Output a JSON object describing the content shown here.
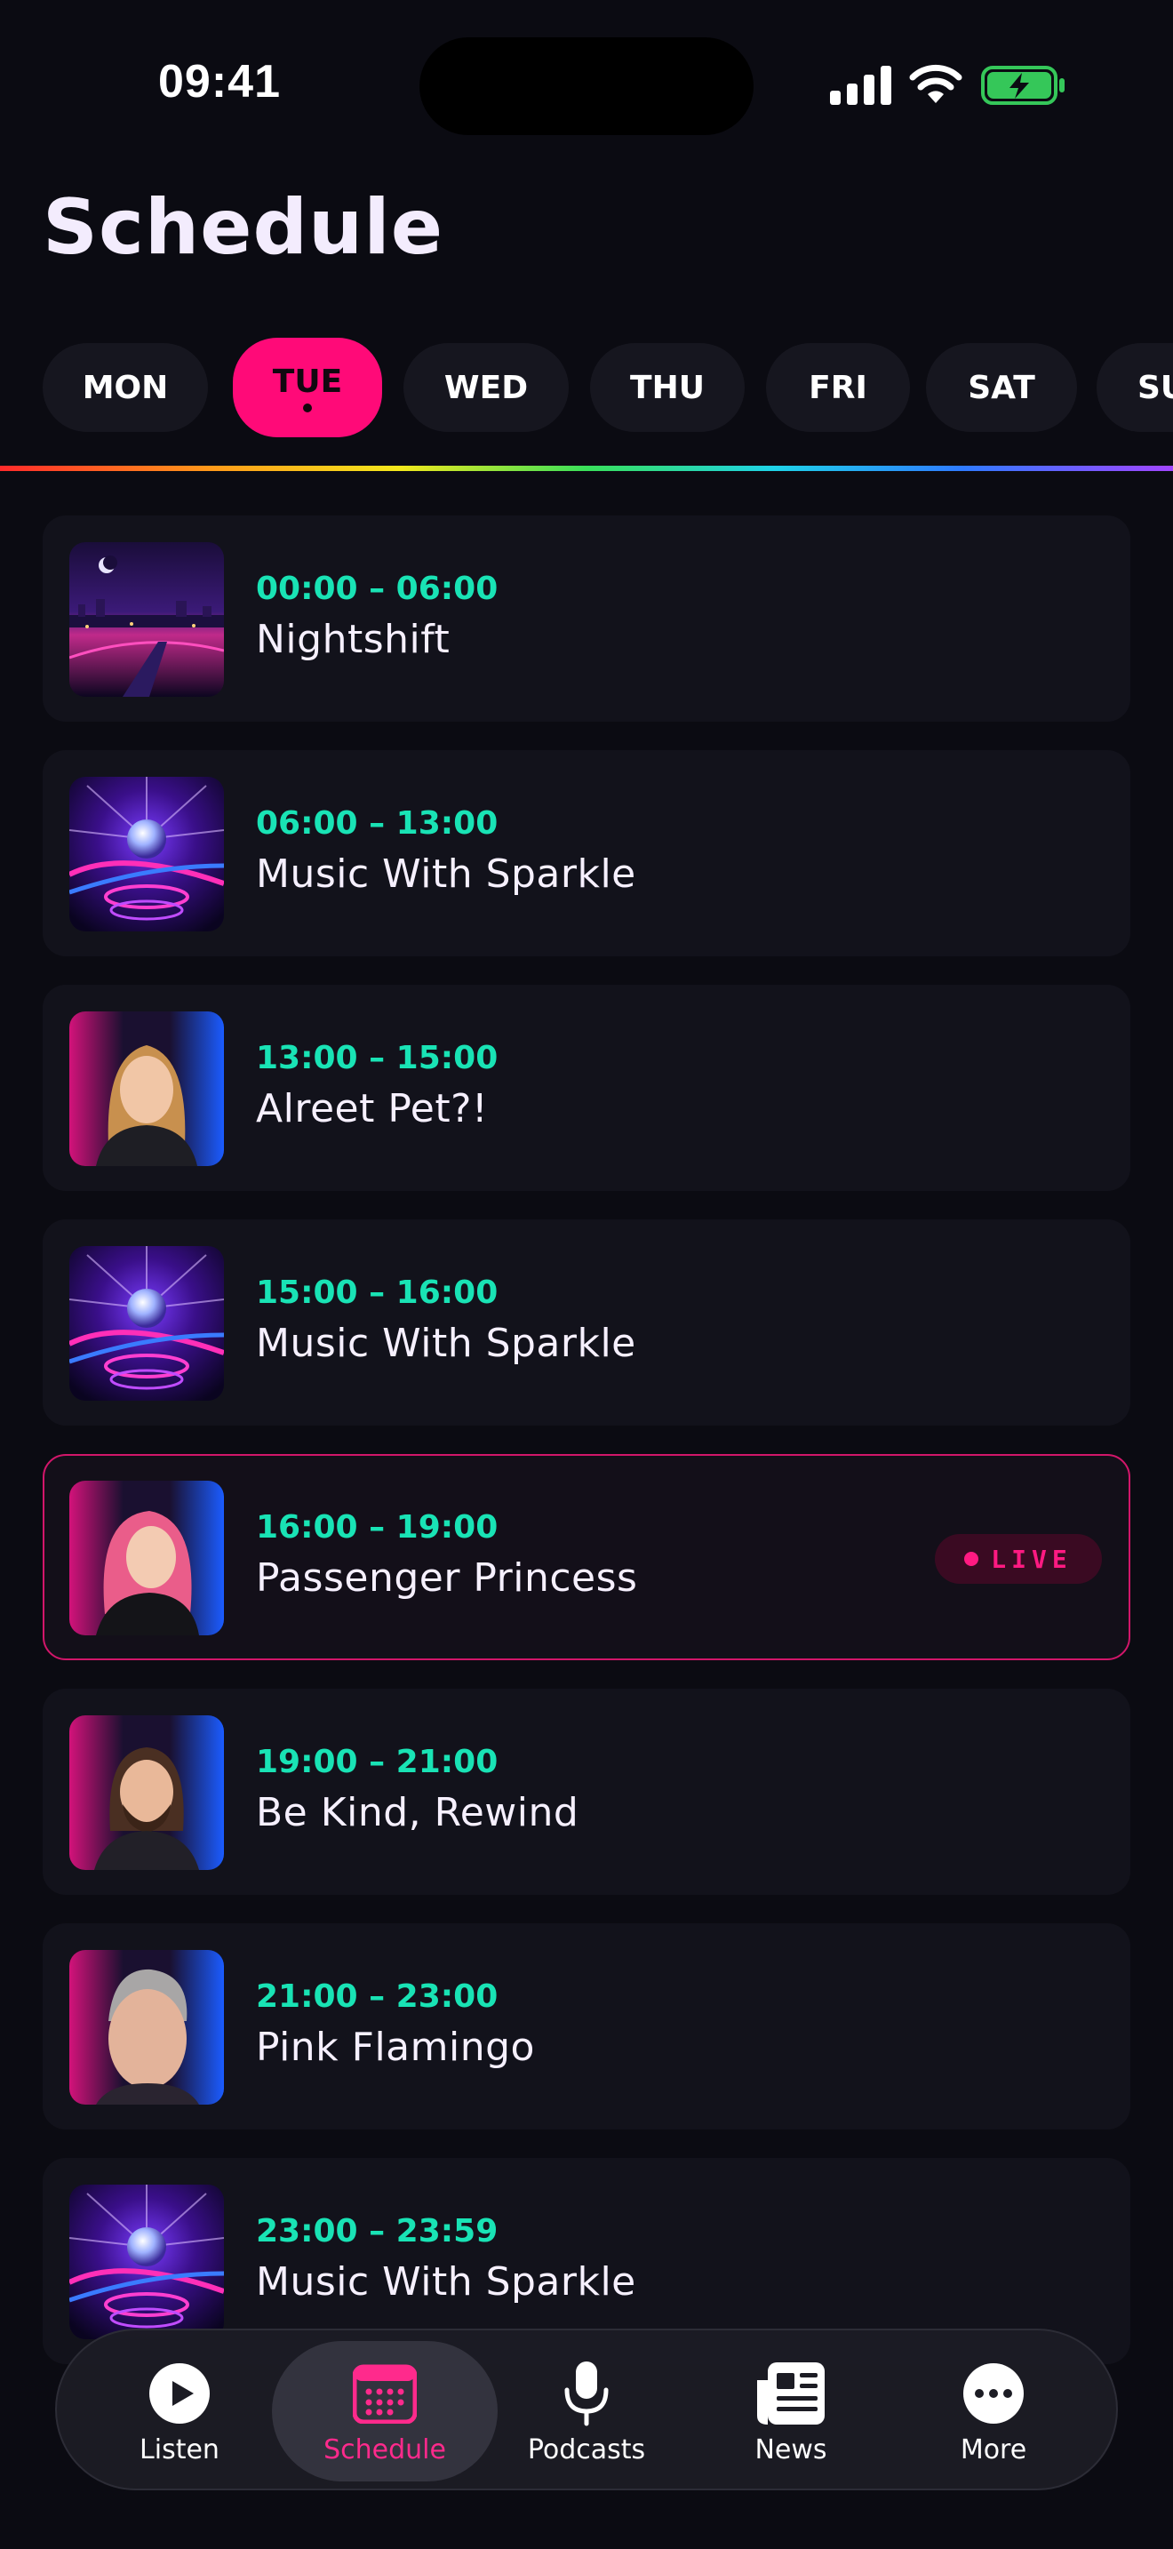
{
  "status_bar": {
    "time": "09:41"
  },
  "page": {
    "title": "Schedule"
  },
  "days": [
    {
      "label": "MON",
      "active": false
    },
    {
      "label": "TUE",
      "active": true
    },
    {
      "label": "WED",
      "active": false
    },
    {
      "label": "THU",
      "active": false
    },
    {
      "label": "FRI",
      "active": false
    },
    {
      "label": "SAT",
      "active": false
    },
    {
      "label": "SUN",
      "active": false
    }
  ],
  "shows": [
    {
      "time": "00:00 – 06:00",
      "title": "Nightshift",
      "art": "night-city-art"
    },
    {
      "time": "06:00 – 13:00",
      "title": "Music With Sparkle",
      "art": "disco-ball-art"
    },
    {
      "time": "13:00 – 15:00",
      "title": "Alreet Pet?!",
      "art": "presenter-photo"
    },
    {
      "time": "15:00 – 16:00",
      "title": "Music With Sparkle",
      "art": "disco-ball-art"
    },
    {
      "time": "16:00 – 19:00",
      "title": "Passenger Princess",
      "art": "presenter-photo",
      "live": true,
      "badge": "LIVE"
    },
    {
      "time": "19:00 – 21:00",
      "title": "Be Kind, Rewind",
      "art": "presenter-photo"
    },
    {
      "time": "21:00 – 23:00",
      "title": "Pink Flamingo",
      "art": "presenter-photo"
    },
    {
      "time": "23:00 – 23:59",
      "title": "Music With Sparkle",
      "art": "disco-ball-art"
    }
  ],
  "nav": [
    {
      "label": "Listen",
      "icon": "play-icon"
    },
    {
      "label": "Schedule",
      "icon": "calendar-icon",
      "active": true
    },
    {
      "label": "Podcasts",
      "icon": "microphone-icon"
    },
    {
      "label": "News",
      "icon": "newspaper-icon"
    },
    {
      "label": "More",
      "icon": "more-icon"
    }
  ],
  "colors": {
    "accent": "#ff0a78",
    "time_text": "#19e3b5",
    "background": "#0b0b12",
    "card": "#12121b"
  }
}
